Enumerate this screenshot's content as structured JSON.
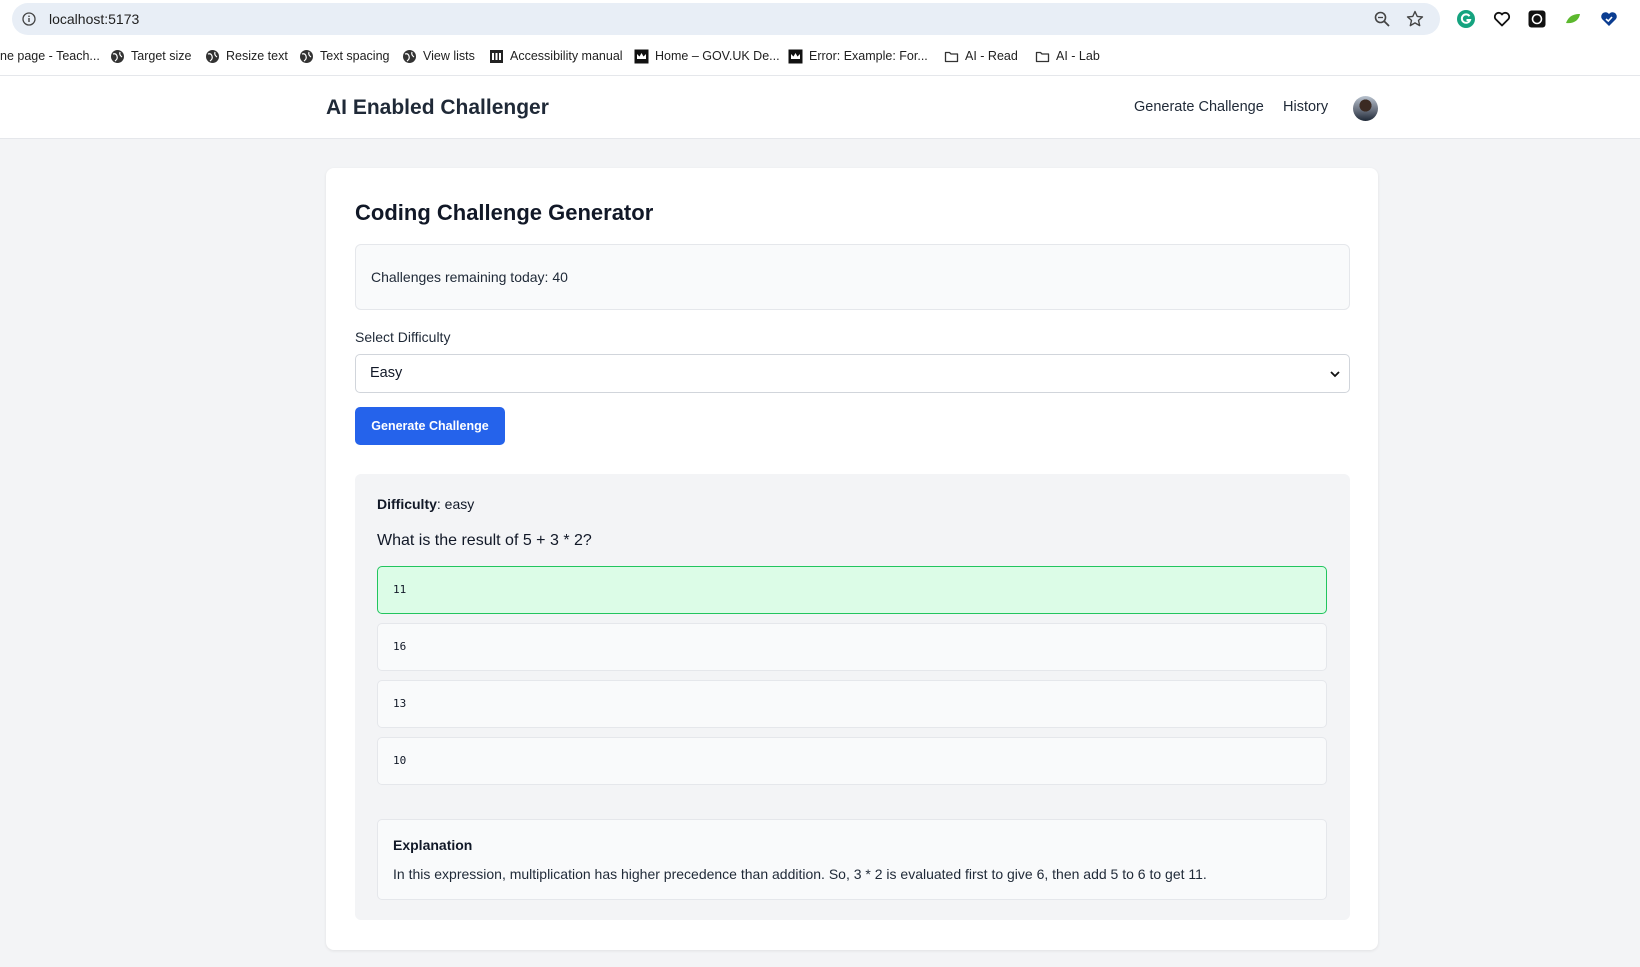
{
  "browser": {
    "url": "localhost:5173",
    "bookmarks": [
      {
        "label": "ne page - Teach...",
        "icon": "page-icon"
      },
      {
        "label": "Target size",
        "icon": "globe-icon"
      },
      {
        "label": "Resize text",
        "icon": "globe-icon"
      },
      {
        "label": "Text spacing",
        "icon": "globe-icon"
      },
      {
        "label": "View lists",
        "icon": "globe-icon"
      },
      {
        "label": "Accessibility manual",
        "icon": "building-icon"
      },
      {
        "label": "Home – GOV.UK De...",
        "icon": "crown-icon"
      },
      {
        "label": "Error: Example: For...",
        "icon": "crown-icon"
      },
      {
        "label": "AI - Read",
        "icon": "folder-icon"
      },
      {
        "label": "AI - Lab",
        "icon": "folder-icon"
      }
    ],
    "extensions": [
      "grammarly-icon",
      "heart-icon",
      "chatgpt-icon",
      "leaf-icon",
      "heart-shield-icon"
    ],
    "colors": {
      "omnibox": "#e8eef6"
    }
  },
  "header": {
    "brand": "AI Enabled Challenger",
    "nav": [
      "Generate Challenge",
      "History"
    ]
  },
  "main": {
    "title": "Coding Challenge Generator",
    "quota_text": "Challenges remaining today: 40",
    "difficulty_label": "Select Difficulty",
    "difficulty_selected": "Easy",
    "generate_button": "Generate Challenge",
    "colors": {
      "primary": "#2563eb",
      "correct_bg": "#dcfce7",
      "correct_border": "#22c55e"
    }
  },
  "challenge": {
    "difficulty_label": "Difficulty",
    "difficulty_value": ": easy",
    "question": "What is the result of 5 + 3 * 2?",
    "options": [
      {
        "text": "11",
        "state": "correct"
      },
      {
        "text": "16",
        "state": "default"
      },
      {
        "text": "13",
        "state": "default"
      },
      {
        "text": "10",
        "state": "default"
      }
    ],
    "explanation_title": "Explanation",
    "explanation_text": "In this expression, multiplication has higher precedence than addition. So, 3 * 2 is evaluated first to give 6, then add 5 to 6 to get 11."
  }
}
